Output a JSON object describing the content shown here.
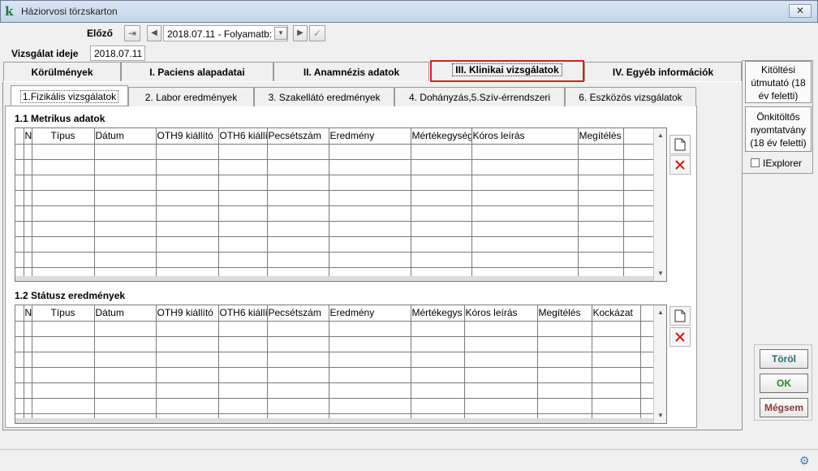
{
  "window": {
    "title": "Háziorvosi törzskarton",
    "close_label": "✕"
  },
  "nav": {
    "prev_label": "Előző",
    "visit_select_value": "2018.07.11 - Folyamatb:",
    "exam_date_label": "Vizsgálat ideje",
    "exam_date_value": "2018.07.11"
  },
  "main_tabs": [
    {
      "label": "Körülmények"
    },
    {
      "label": "I. Paciens alapadatai"
    },
    {
      "label": "II. Anamnézis adatok"
    },
    {
      "label": "III. Klinikai vizsgálatok"
    },
    {
      "label": "IV. Egyéb információk"
    }
  ],
  "sub_tabs": [
    {
      "label": "1.Fizikális vizsgálatok"
    },
    {
      "label": "2. Labor eredmények"
    },
    {
      "label": "3. Szakellátó eredmények"
    },
    {
      "label": "4. Dohányzás,5.Szív-érrendszeri"
    },
    {
      "label": "6. Eszközös vizsgálatok"
    }
  ],
  "section1": {
    "title": "1.1 Metrikus adatok",
    "columns": [
      "",
      "N",
      "Típus",
      "Dátum",
      "OTH9 kiállító",
      "OTH6 kiállí",
      "Pecsétszám",
      "Eredmény",
      "Mértékegység",
      "Kóros leírás",
      "Megítélés",
      ""
    ]
  },
  "section2": {
    "title": "1.2 Státusz eredmények",
    "columns": [
      "",
      "N",
      "Típus",
      "Dátum",
      "OTH9 kiállító",
      "OTH6 kiállí",
      "Pecsétszám",
      "Eredmény",
      "Mértékegys",
      "Kóros leírás",
      "Megítélés",
      "Kockázat",
      ""
    ]
  },
  "right_panel": {
    "guide_button": "Kitöltési útmutató (18 év feletti)",
    "selfform_button": "Önkitöltős nyomtatvány (18 év feletti)",
    "iexplorer_label": "IExplorer"
  },
  "actions": {
    "delete_label": "Töröl",
    "ok_label": "OK",
    "cancel_label": "Mégsem"
  },
  "colors": {
    "ok_text": "#1e8a2e",
    "delete_text": "#2a6b6e",
    "cancel_text": "#8b3a3a",
    "active_tab_border": "#d62020"
  }
}
